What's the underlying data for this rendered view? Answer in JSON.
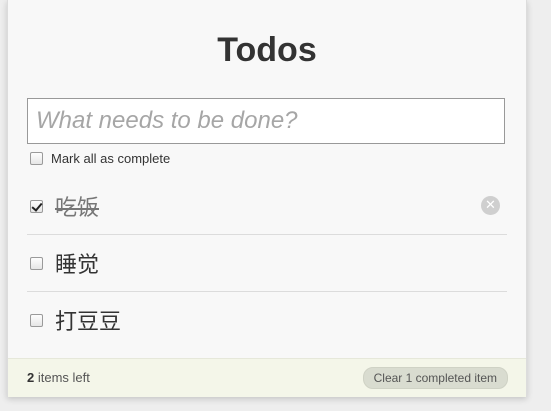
{
  "app": {
    "title": "Todos"
  },
  "new_todo": {
    "placeholder": "What needs to be done?",
    "value": ""
  },
  "toggle_all": {
    "label": "Mark all as complete",
    "checked": false
  },
  "todos": [
    {
      "text": "吃饭",
      "completed": true
    },
    {
      "text": "睡觉",
      "completed": false
    },
    {
      "text": "打豆豆",
      "completed": false
    }
  ],
  "footer": {
    "count": "2",
    "count_suffix": " items left",
    "clear_label": "Clear 1 completed item"
  },
  "icons": {
    "destroy": "close-icon",
    "checkbox": "checkbox"
  }
}
